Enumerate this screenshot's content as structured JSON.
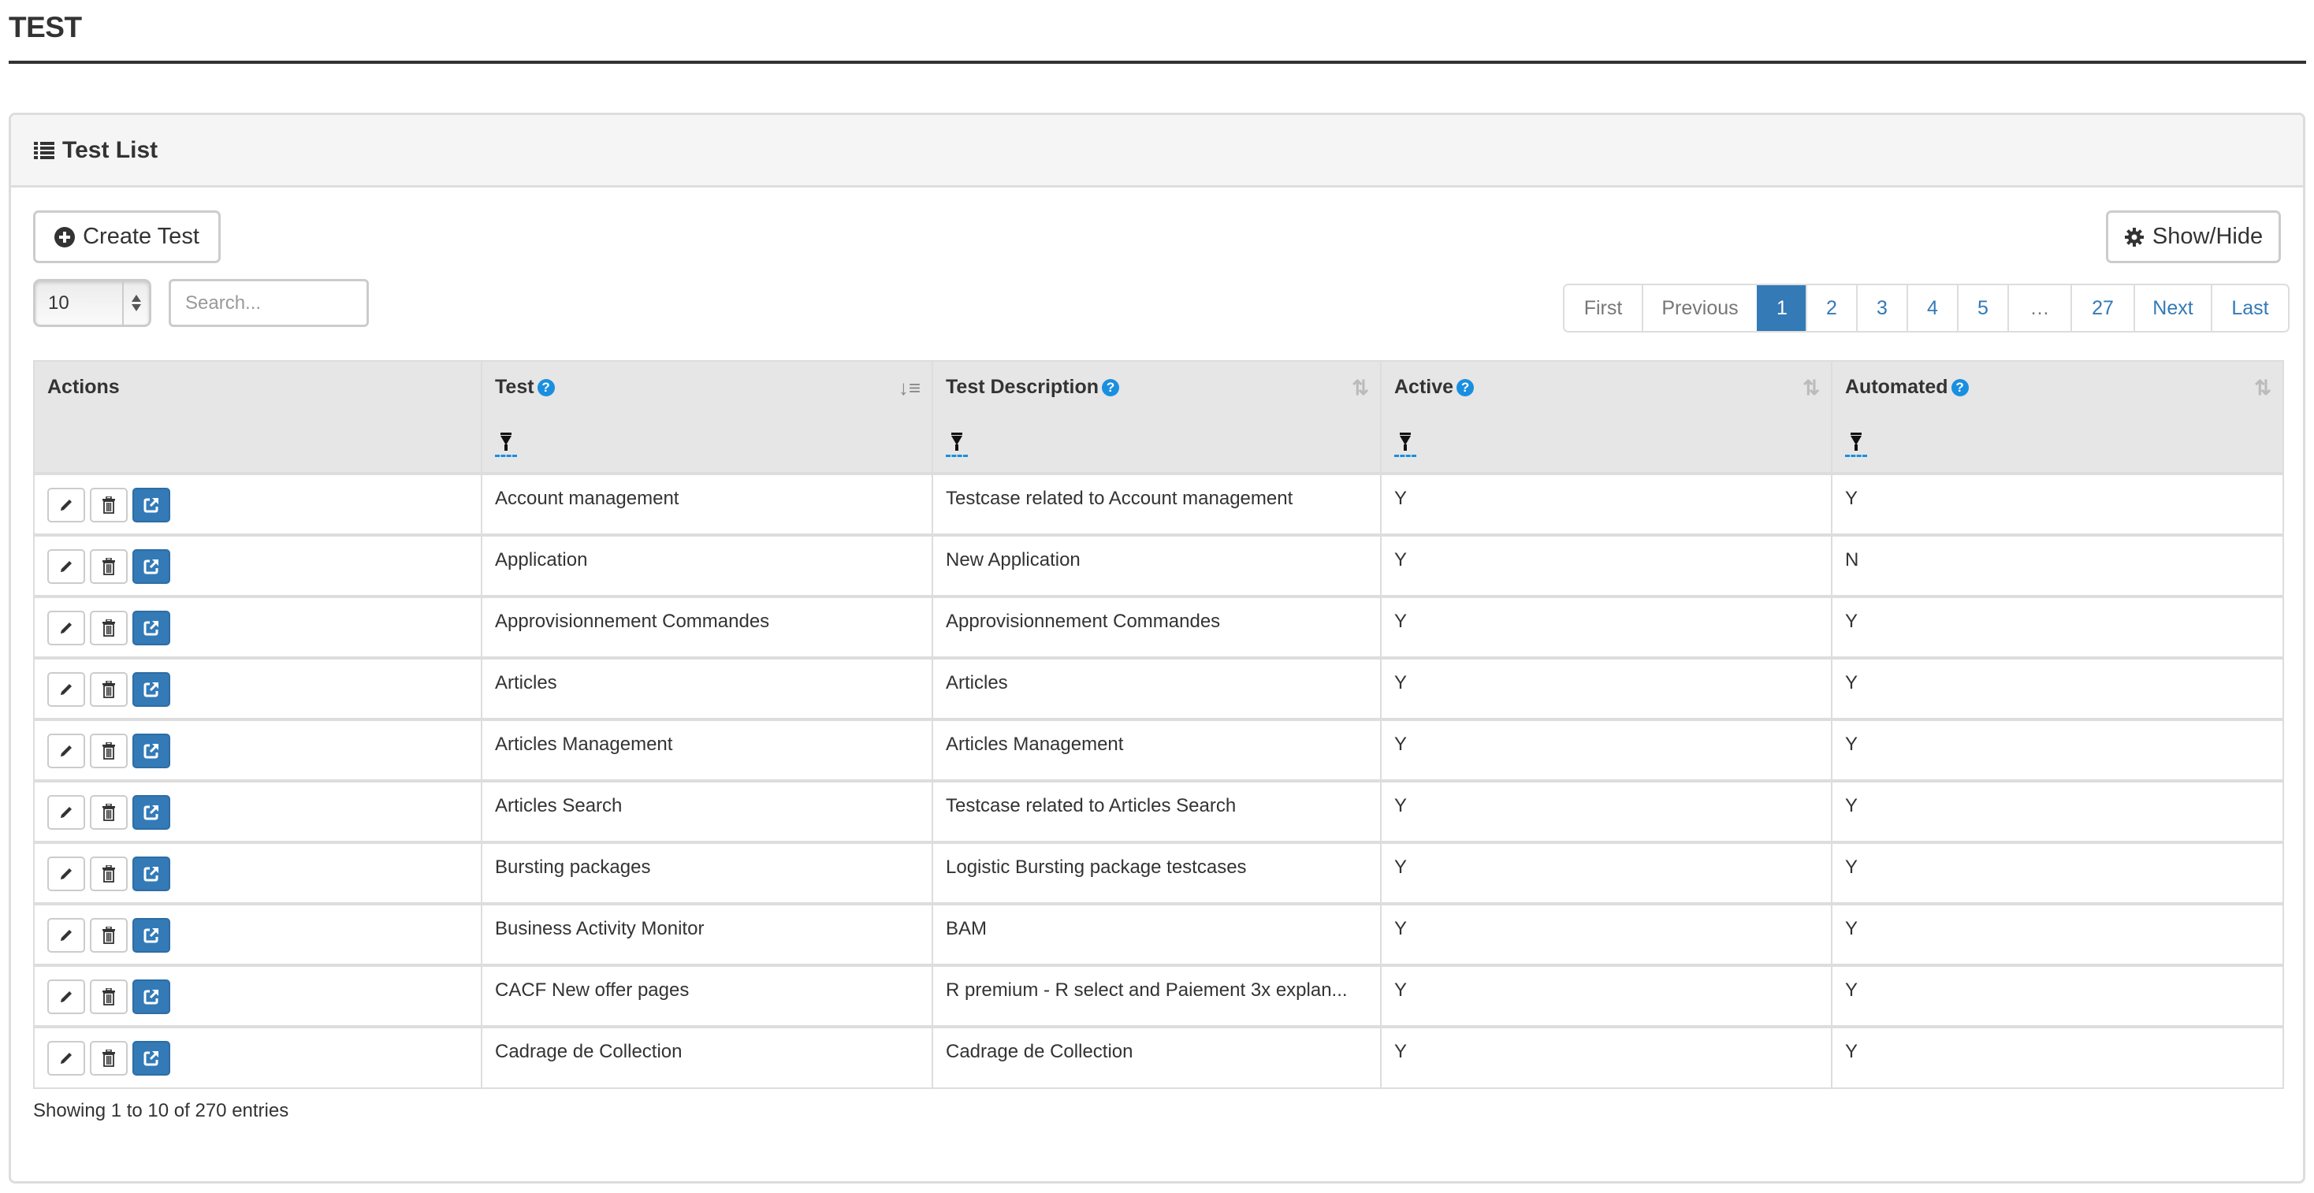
{
  "page": {
    "title": "TEST"
  },
  "panel": {
    "title": "Test List",
    "icon": "list-icon"
  },
  "toolbar": {
    "create_label": "Create Test",
    "create_icon": "plus-circle-icon",
    "showhide_label": "Show/Hide",
    "showhide_icon": "gear-icon"
  },
  "length_select": {
    "value": "10"
  },
  "search": {
    "placeholder": "Search...",
    "value": ""
  },
  "pagination": {
    "items": [
      {
        "label": "First",
        "state": "disabled"
      },
      {
        "label": "Previous",
        "state": "disabled"
      },
      {
        "label": "1",
        "state": "active"
      },
      {
        "label": "2",
        "state": "normal"
      },
      {
        "label": "3",
        "state": "normal"
      },
      {
        "label": "4",
        "state": "normal"
      },
      {
        "label": "5",
        "state": "normal"
      },
      {
        "label": "…",
        "state": "disabled"
      },
      {
        "label": "27",
        "state": "normal"
      },
      {
        "label": "Next",
        "state": "normal"
      },
      {
        "label": "Last",
        "state": "normal"
      }
    ]
  },
  "table": {
    "columns": [
      {
        "label": "Actions",
        "help": false,
        "sortable": false
      },
      {
        "label": "Test",
        "help": true,
        "sortable": true,
        "sort": "ascending"
      },
      {
        "label": "Test Description",
        "help": true,
        "sortable": true,
        "sort": "none"
      },
      {
        "label": "Active",
        "help": true,
        "sortable": true,
        "sort": "none"
      },
      {
        "label": "Automated",
        "help": true,
        "sortable": true,
        "sort": "none"
      }
    ],
    "actions": [
      "edit-icon",
      "trash-icon",
      "external-link-icon"
    ],
    "rows": [
      {
        "test": "Account management",
        "description": "Testcase related to Account management",
        "active": "Y",
        "automated": "Y"
      },
      {
        "test": "Application",
        "description": "New Application",
        "active": "Y",
        "automated": "N"
      },
      {
        "test": "Approvisionnement Commandes",
        "description": "Approvisionnement Commandes",
        "active": "Y",
        "automated": "Y"
      },
      {
        "test": "Articles",
        "description": "Articles",
        "active": "Y",
        "automated": "Y"
      },
      {
        "test": "Articles Management",
        "description": "Articles Management",
        "active": "Y",
        "automated": "Y"
      },
      {
        "test": "Articles Search",
        "description": "Testcase related to Articles Search",
        "active": "Y",
        "automated": "Y"
      },
      {
        "test": "Bursting packages",
        "description": "Logistic Bursting package testcases",
        "active": "Y",
        "automated": "Y"
      },
      {
        "test": "Business Activity Monitor",
        "description": "BAM",
        "active": "Y",
        "automated": "Y"
      },
      {
        "test": "CACF New offer pages",
        "description": "R premium - R select and Paiement 3x explan...",
        "active": "Y",
        "automated": "Y"
      },
      {
        "test": "Cadrage de Collection",
        "description": "Cadrage de Collection",
        "active": "Y",
        "automated": "Y"
      }
    ]
  },
  "info": {
    "text": "Showing 1 to 10 of 270 entries"
  },
  "colors": {
    "primary": "#337ab7",
    "help": "#1a8fe0",
    "header_bg": "#e6e6e6",
    "panel_heading_bg": "#f5f5f5"
  }
}
